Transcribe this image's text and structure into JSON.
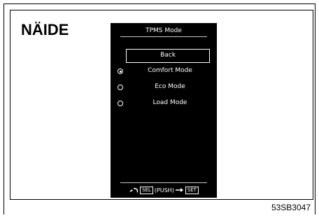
{
  "page": {
    "example_label": "NÄIDE",
    "code": "53SB3047"
  },
  "screen": {
    "title": "TPMS Mode",
    "back_label": "Back",
    "options": [
      {
        "label": "Comfort Mode",
        "selected": true
      },
      {
        "label": "Eco Mode",
        "selected": false
      },
      {
        "label": "Load Mode",
        "selected": false
      }
    ],
    "hint": {
      "sel_key": "SEL",
      "push_text": "(PUSH)",
      "set_key": "SET",
      "rotate_icon": "rotate-knob-icon",
      "push_icon": "arrow-right-icon"
    }
  }
}
